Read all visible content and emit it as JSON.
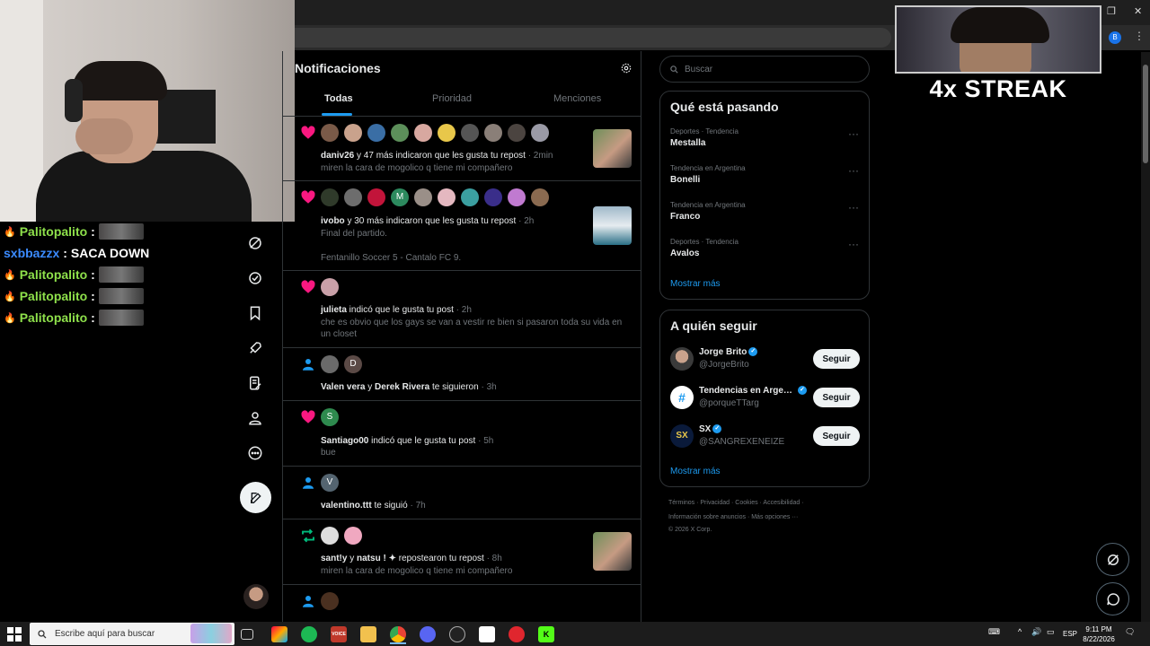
{
  "colors": {
    "accent": "#1d9bf0",
    "like": "#f91880",
    "repost": "#00ba7c",
    "follow": "#1d9bf0"
  },
  "stream": {
    "streak_text": "4x STREAK",
    "chat": [
      {
        "user": "Palitopalito",
        "sep": ":",
        "msg": "",
        "color": "green",
        "emote": true
      },
      {
        "user": "sxbbazzx",
        "sep": ":",
        "msg": "SACA DOWN",
        "color": "blue",
        "emote": false
      },
      {
        "user": "Palitopalito",
        "sep": ":",
        "msg": "",
        "color": "green",
        "emote": true
      },
      {
        "user": "Palitopalito",
        "sep": ":",
        "msg": "",
        "color": "green",
        "emote": true
      },
      {
        "user": "Palitopalito",
        "sep": ":",
        "msg": "",
        "color": "green",
        "emote": true
      }
    ]
  },
  "browser": {
    "profile_initial": "B"
  },
  "nav": {
    "icons": [
      "grok-icon",
      "verified-icon",
      "bookmark-icon",
      "rocket-icon",
      "lists-icon",
      "profile-icon",
      "more-icon"
    ],
    "compose": "compose-icon"
  },
  "header": {
    "title": "Notificaciones"
  },
  "tabs": [
    {
      "label": "Todas",
      "active": true
    },
    {
      "label": "Prioridad",
      "active": false
    },
    {
      "label": "Menciones",
      "active": false
    }
  ],
  "notifications": [
    {
      "type": "like",
      "actor": "daniv26",
      "text": " y 47 más indicaron que les gusta tu repost",
      "time": " · 2min",
      "sub": "miren la cara de mogolico q tiene mi compañero",
      "sub2": ""
    },
    {
      "type": "like",
      "actor": "ivobo",
      "text": " y 30 más indicaron que les gusta tu repost",
      "time": " · 2h",
      "sub": "Final del partido.",
      "sub2": "Fentanillo Soccer 5 - Cantalo FC 9."
    },
    {
      "type": "like",
      "actor": "julieta",
      "text": " indicó que le gusta tu post",
      "time": " · 2h",
      "sub": "che es obvio que los gays se van a vestir re bien si pasaron toda su vida en un closet",
      "sub2": ""
    },
    {
      "type": "follow",
      "actor": "Valen vera",
      "mid": " y ",
      "actor2": "Derek Rivera",
      "text": " te siguieron",
      "time": " · 3h",
      "sub": "",
      "sub2": ""
    },
    {
      "type": "like",
      "actor": "Santiago00",
      "text": " indicó que le gusta tu post",
      "time": " · 5h",
      "sub": "bue",
      "sub2": ""
    },
    {
      "type": "follow",
      "actor": "valentino.ttt",
      "text": " te siguió",
      "time": " · 7h",
      "sub": "",
      "sub2": ""
    },
    {
      "type": "repost",
      "actor": "sant!y",
      "mid": " y ",
      "actor2": "natsu ! ✦",
      "text": " repostearon tu repost",
      "time": " · 8h",
      "sub": "miren la cara de mogolico q tiene mi compañero",
      "sub2": ""
    }
  ],
  "avatar_letters": {
    "row2_m": "M",
    "row4_d": "D",
    "row5_s": "S",
    "row6_v": "V"
  },
  "search": {
    "placeholder": "Buscar"
  },
  "trends": {
    "title": "Qué está pasando",
    "items": [
      {
        "meta": "Deportes · Tendencia",
        "name": "Mestalla"
      },
      {
        "meta": "Tendencia en Argentina",
        "name": "Bonelli"
      },
      {
        "meta": "Tendencia en Argentina",
        "name": "Franco"
      },
      {
        "meta": "Deportes · Tendencia",
        "name": "Avalos"
      }
    ],
    "show_more": "Mostrar más"
  },
  "who_to_follow": {
    "title": "A quién seguir",
    "items": [
      {
        "name": "Jorge Brito",
        "handle": "@JorgeBrito",
        "button": "Seguir"
      },
      {
        "name": "Tendencias en Arge…",
        "handle": "@porqueTTarg",
        "button": "Seguir"
      },
      {
        "name": "SX",
        "handle": "@SANGREXENEIZE",
        "button": "Seguir"
      }
    ],
    "show_more": "Mostrar más"
  },
  "footer": {
    "line1": "Términos  ·  Privacidad  ·  Cookies  ·  Accesibilidad  ·",
    "line2": "Información sobre anuncios  ·  Más opciones ···",
    "line3": "© 2026 X Corp."
  },
  "taskbar": {
    "search_placeholder": "Escribe aquí para buscar",
    "lang": "ESP",
    "time": "9:11 PM",
    "date": "8/22/2026",
    "vote_label": "VOICE"
  }
}
